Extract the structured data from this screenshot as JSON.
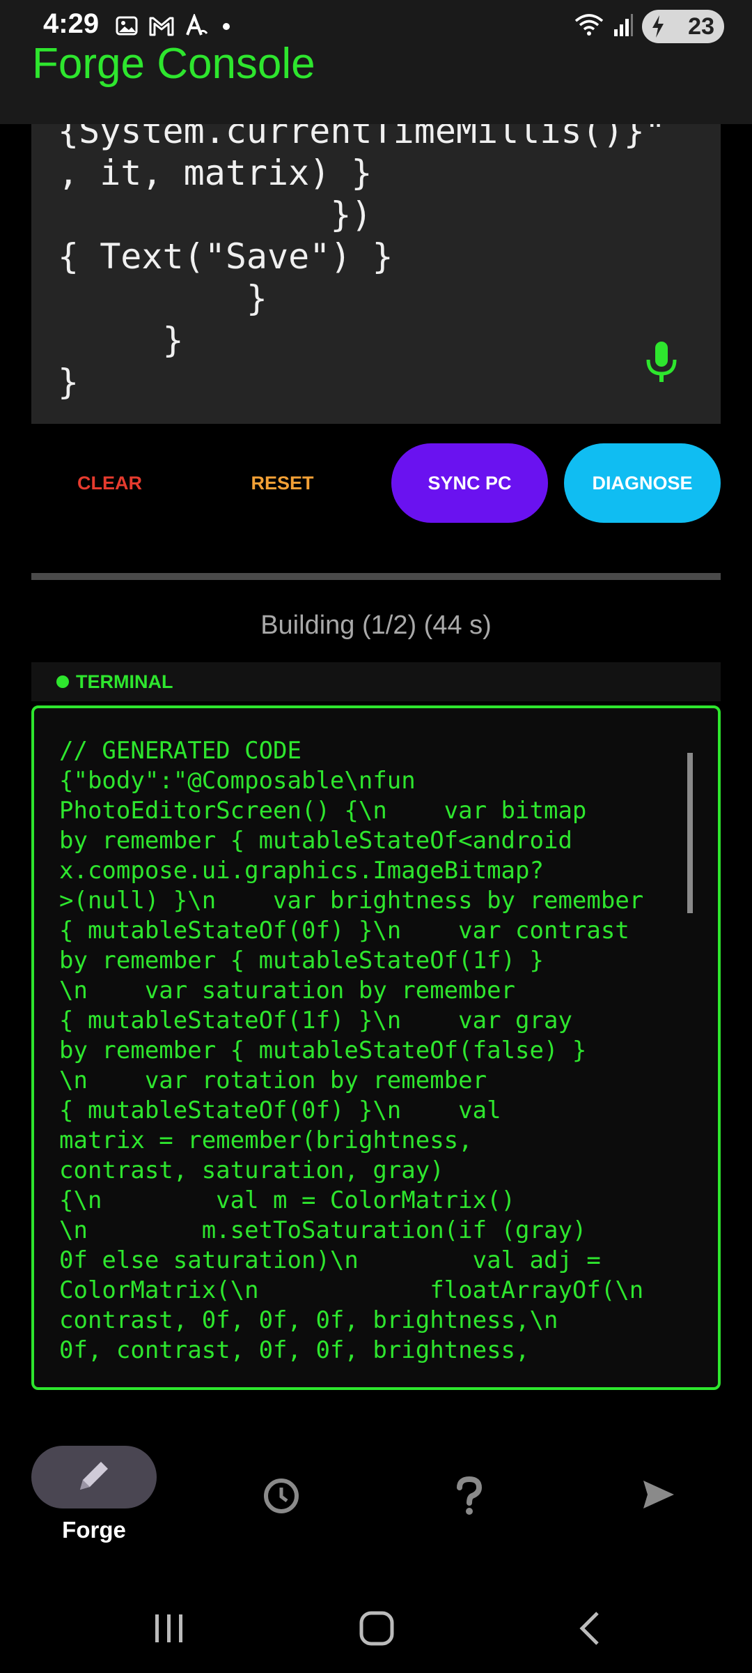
{
  "status_bar": {
    "time": "4:29",
    "battery": "23",
    "notification_icons": [
      "gallery-icon",
      "gmail-icon",
      "font-icon",
      "dot-icon"
    ],
    "system_icons": [
      "wifi-icon",
      "signal-icon",
      "battery-icon"
    ]
  },
  "app": {
    "title": "Forge Console"
  },
  "editor": {
    "lines": [
      "{System.currentTimeMillis()}\"",
      ", it, matrix) }",
      "             })",
      "{ Text(\"Save\") }",
      "         }",
      "     }",
      "}"
    ]
  },
  "buttons": {
    "clear": "CLEAR",
    "reset": "RESET",
    "sync": "SYNC PC",
    "diagnose": "DIAGNOSE"
  },
  "build_status": "Building (1/2) (44 s)",
  "terminal": {
    "title": "TERMINAL",
    "lines": [
      "// GENERATED CODE",
      "{\"body\":\"@Composable\\nfun",
      "PhotoEditorScreen() {\\n    var bitmap",
      "by remember { mutableStateOf<android",
      "x.compose.ui.graphics.ImageBitmap?",
      ">(null) }\\n    var brightness by remember",
      "{ mutableStateOf(0f) }\\n    var contrast",
      "by remember { mutableStateOf(1f) }",
      "\\n    var saturation by remember",
      "{ mutableStateOf(1f) }\\n    var gray",
      "by remember { mutableStateOf(false) }",
      "\\n    var rotation by remember",
      "{ mutableStateOf(0f) }\\n    val",
      "matrix = remember(brightness,",
      "contrast, saturation, gray)",
      "{\\n        val m = ColorMatrix()",
      "\\n        m.setToSaturation(if (gray)",
      "0f else saturation)\\n        val adj =",
      "ColorMatrix(\\n            floatArrayOf(\\n",
      "contrast, 0f, 0f, 0f, brightness,\\n",
      "0f, contrast, 0f, 0f, brightness,"
    ]
  },
  "bottom_nav": {
    "forge_label": "Forge"
  },
  "colors": {
    "accent_green": "#2ee62e",
    "clear_red": "#e63b2e",
    "reset_orange": "#f3a136",
    "sync_purple": "#6a12f0",
    "diagnose_cyan": "#10bdf2"
  }
}
